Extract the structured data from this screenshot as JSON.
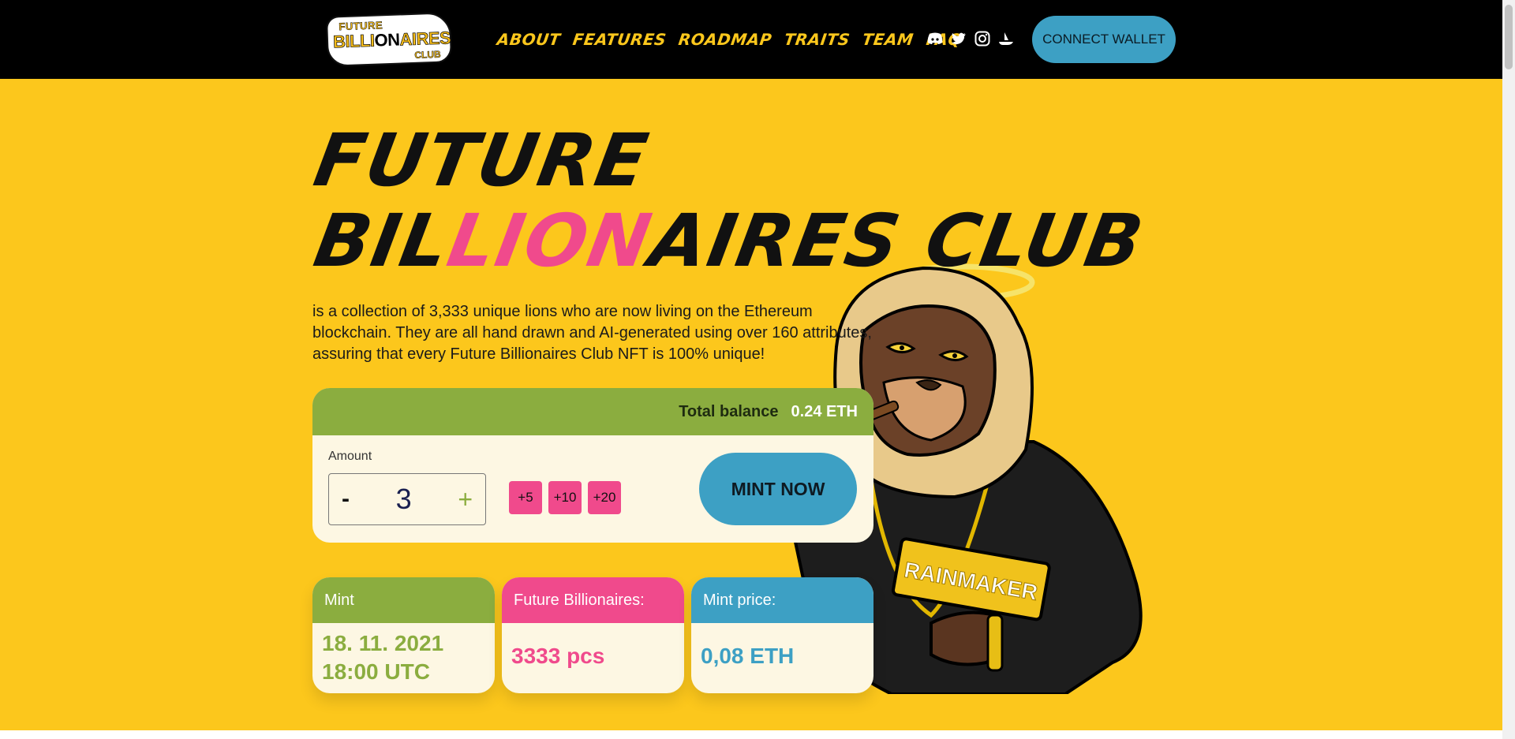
{
  "nav": {
    "logo": {
      "line1": "FUTURE",
      "line2_a": "BILLI",
      "line2_b": "ON",
      "line2_c": "AIRES",
      "line3": "CLUB"
    },
    "menu": [
      "ABOUT",
      "FEATURES",
      "ROADMAP",
      "TRAITS",
      "TEAM",
      "FAQ"
    ],
    "socials": [
      "discord-icon",
      "twitter-icon",
      "instagram-icon",
      "opensea-icon"
    ],
    "connect_label": "CONNECT WALLET"
  },
  "hero": {
    "title_line1": "FUTURE",
    "title_line2_a": "BIL",
    "title_line2_b": "LION",
    "title_line2_c": "AIRES CLUB",
    "description": "is a collection of 3,333 unique lions who are now living on the Ethereum blockchain. They are all hand drawn and AI-generated using over 160 attributes, assuring that every Future Billionaires Club NFT is 100% unique!",
    "character_badge": "RAINMAKER"
  },
  "mint_panel": {
    "balance_label": "Total balance",
    "balance_value": "0.24 ETH",
    "amount_label": "Amount",
    "minus": "-",
    "quantity": "3",
    "plus": "+",
    "quick_adds": [
      "+5",
      "+10",
      "+20"
    ],
    "mint_label": "MINT NOW"
  },
  "stats": [
    {
      "label": "Mint",
      "value_line1": "18. 11. 2021",
      "value_line2": "18:00 UTC"
    },
    {
      "label": "Future Billionaires:",
      "value": "3333 pcs"
    },
    {
      "label": "Mint price:",
      "value": "0,08 ETH"
    }
  ],
  "colors": {
    "background": "#fcc71c",
    "green": "#8bad3f",
    "pink": "#f04a8c",
    "blue": "#3da0c4",
    "nav": "#000000"
  }
}
